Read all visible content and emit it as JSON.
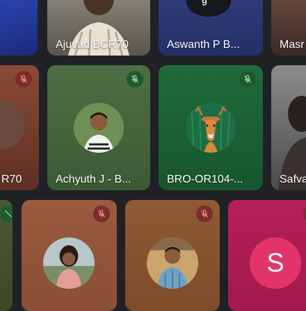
{
  "participants": [
    {
      "name": "",
      "avatar": "partial-video"
    },
    {
      "name": "Ajuvad BCR70",
      "avatar": "video-camera-feed"
    },
    {
      "name": "Aswanth P B...",
      "avatar": "video-camera-feed"
    },
    {
      "name": "Masr",
      "avatar": "video-camera-feed"
    },
    {
      "name": "R70",
      "muted": true,
      "avatar": "photo"
    },
    {
      "name": "Achyuth J - B...",
      "muted": true,
      "avatar": "photo"
    },
    {
      "name": "BRO-OR104-...",
      "muted": true,
      "avatar": "deer-illustration"
    },
    {
      "name": "Safva",
      "avatar": "photo"
    },
    {
      "name": "",
      "muted": true,
      "avatar": "photo"
    },
    {
      "name": "",
      "muted": true,
      "avatar": "photo"
    },
    {
      "name": "",
      "muted": true,
      "avatar": "photo"
    },
    {
      "name": "",
      "avatar": "initial",
      "initial": "S"
    }
  ],
  "colors": {
    "background": "#202124",
    "mute_badge_red": "#7a2d2a",
    "mute_badge_green": "#1e5a2c",
    "initial_avatar": "#e4336a"
  }
}
